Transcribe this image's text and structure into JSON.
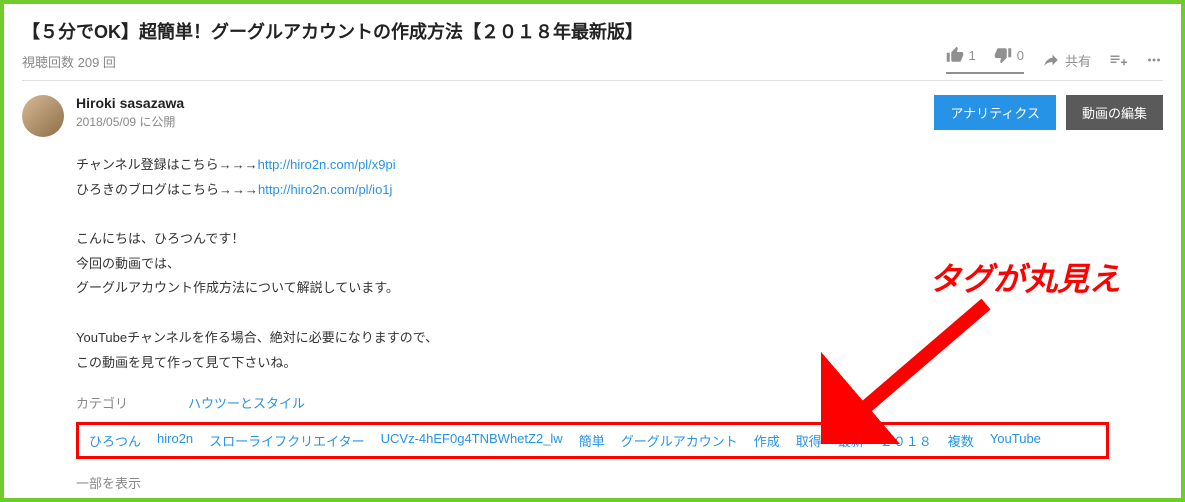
{
  "video": {
    "title": "【５分でOK】超簡単！グーグルアカウントの作成方法【２０１８年最新版】",
    "views_label": "視聴回数 209 回"
  },
  "actions": {
    "like_count": "1",
    "dislike_count": "0",
    "share_label": "共有"
  },
  "channel": {
    "name": "Hiroki sasazawa",
    "published": "2018/05/09 に公開"
  },
  "buttons": {
    "analytics": "アナリティクス",
    "edit": "動画の編集"
  },
  "description": {
    "line1_prefix": "チャンネル登録はこちら→→→",
    "line1_link": "http://hiro2n.com/pl/x9pi",
    "line2_prefix": "ひろきのブログはこちら→→→",
    "line2_link": "http://hiro2n.com/pl/io1j",
    "line3": "こんにちは、ひろつんです！",
    "line4": "今回の動画では、",
    "line5": "グーグルアカウント作成方法について解説しています。",
    "line6": "YouTubeチャンネルを作る場合、絶対に必要になりますので、",
    "line7": "この動画を見て作って見て下さいね。"
  },
  "category": {
    "label": "カテゴリ",
    "value": "ハウツーとスタイル"
  },
  "tags": [
    "ひろつん",
    "hiro2n",
    "スローライフクリエイター",
    "UCVz-4hEF0g4TNBWhetZ2_lw",
    "簡単",
    "グーグルアカウント",
    "作成",
    "取得",
    "最新",
    "２０１８",
    "複数",
    "YouTube"
  ],
  "show_less": "一部を表示",
  "callout_text": "タグが丸見え"
}
